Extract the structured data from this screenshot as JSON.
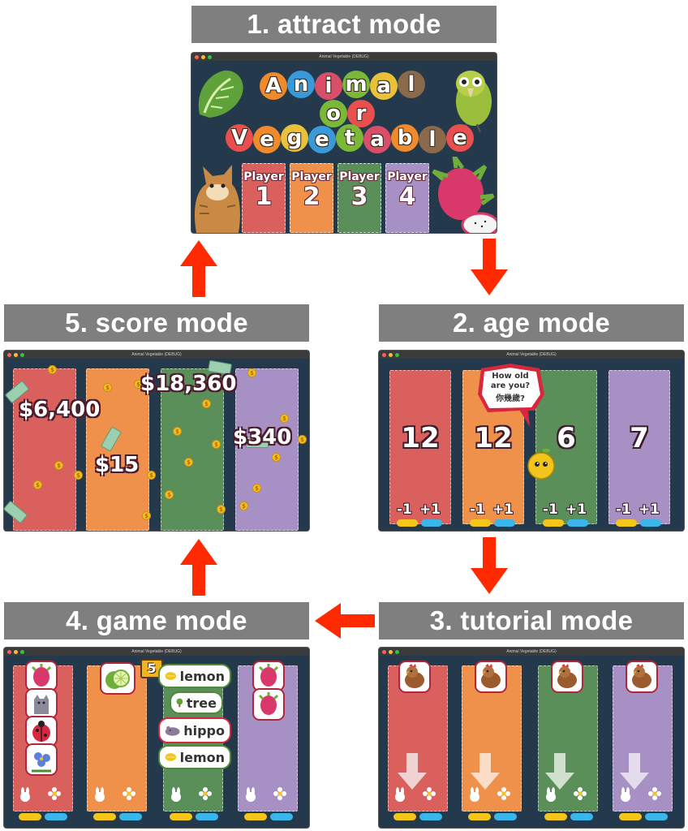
{
  "stages": {
    "attract": "1. attract mode",
    "age": "2. age mode",
    "tutorial": "3. tutorial mode",
    "game": "4. game mode",
    "score": "5. score mode"
  },
  "window_title": "Animal Vegetable (DEBUG)",
  "attract": {
    "logo_line1": [
      "A",
      "n",
      "i",
      "m",
      "a",
      "l"
    ],
    "logo_line2": [
      "o",
      "r"
    ],
    "logo_line3": [
      "V",
      "e",
      "g",
      "e",
      "t",
      "a",
      "b",
      "l",
      "e"
    ],
    "player_label": "Player",
    "players": [
      "1",
      "2",
      "3",
      "4"
    ]
  },
  "age": {
    "bubble_line1": "How old",
    "bubble_line2": "are you?",
    "bubble_line3": "你幾歲?",
    "ages": [
      "12",
      "12",
      "6",
      "7"
    ],
    "minus": "-1",
    "plus": "+1"
  },
  "score": {
    "values": [
      "$6,400",
      "$15",
      "$18,360",
      "$340"
    ],
    "coin_symbol": "$"
  },
  "game": {
    "counter": "5",
    "words": [
      "lemon",
      "tree",
      "hippo",
      "lemon"
    ]
  },
  "colors": {
    "arrow": "#ff2a00",
    "label_bg": "#7f7f7f",
    "red": "#d9605c",
    "orange": "#f0914b",
    "green": "#5a8f5a",
    "purple": "#a690c4"
  }
}
